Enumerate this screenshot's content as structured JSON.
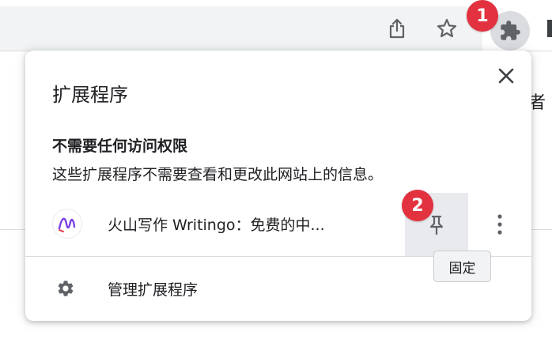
{
  "toolbar": {
    "share_icon": "share-icon",
    "star_icon": "star-icon",
    "extensions_icon": "puzzle-icon",
    "page_text": "者"
  },
  "markers": {
    "first": "1",
    "second": "2"
  },
  "popup": {
    "title": "扩展程序",
    "close_icon": "close-icon",
    "section": {
      "heading": "不需要任何访问权限",
      "description": "这些扩展程序不需要查看和更改此网站上的信息。"
    },
    "extension": {
      "name": "火山写作 Writingo：免费的中...",
      "pin_icon": "pin-icon",
      "menu_icon": "more-vert-icon"
    },
    "manage": {
      "label": "管理扩展程序",
      "icon": "gear-icon"
    }
  },
  "tooltip": {
    "text": "固定"
  },
  "colors": {
    "marker": "#e2323f",
    "extension_logo": "#7b3fe4",
    "pin_hover": "#e8eaed"
  }
}
